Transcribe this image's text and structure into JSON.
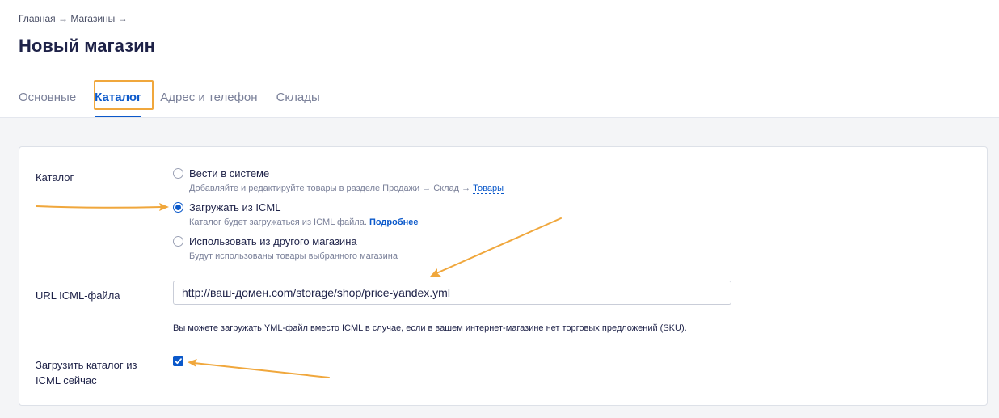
{
  "breadcrumb": {
    "home": "Главная",
    "sep1": "→",
    "shops": "Магазины",
    "sep2": "→"
  },
  "page_title": "Новый магазин",
  "tabs": [
    {
      "label": "Основные",
      "active": false
    },
    {
      "label": "Каталог",
      "active": true
    },
    {
      "label": "Адрес и телефон",
      "active": false
    },
    {
      "label": "Склады",
      "active": false
    }
  ],
  "form": {
    "catalog_label": "Каталог",
    "options": [
      {
        "title": "Вести в системе",
        "hint": "Добавляйте и редактируйте товары в разделе Продажи → Склад →",
        "hint_link": "Товары",
        "checked": false
      },
      {
        "title": "Загружать из ICML",
        "hint": "Каталог будет загружаться из ICML файла.",
        "hint_link": "Подробнее",
        "checked": true
      },
      {
        "title": "Использовать из другого магазина",
        "hint": "Будут использованы товары выбранного магазина",
        "checked": false
      }
    ],
    "url_label": "URL ICML-файла",
    "url_value": "http://ваш-домен.com/storage/shop/price-yandex.yml",
    "note": "Вы можете загружать YML-файл вместо ICML в случае, если в вашем интернет-магазине нет торговых предложений (SKU).",
    "load_label_line1": "Загрузить каталог из",
    "load_label_line2": "ICML сейчас",
    "load_checked": true
  },
  "colors": {
    "accent": "#0a58ca",
    "annotation": "#f0a73c"
  }
}
